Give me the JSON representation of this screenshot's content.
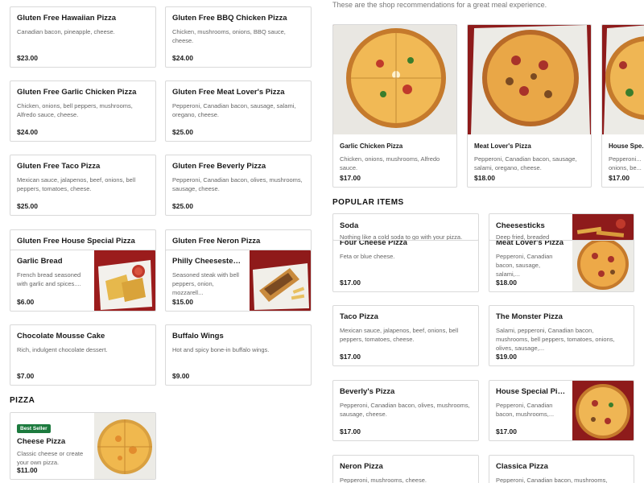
{
  "left_cards": [
    {
      "title": "Gluten Free Hawaiian Pizza",
      "desc": "Canadian bacon, pineapple, cheese.",
      "price": "$23.00"
    },
    {
      "title": "Gluten Free BBQ Chicken Pizza",
      "desc": "Chicken, mushrooms, onions, BBQ sauce, cheese.",
      "price": "$24.00"
    },
    {
      "title": "Gluten Free Garlic Chicken Pizza",
      "desc": "Chicken, onions, bell peppers, mushrooms, Alfredo sauce, cheese.",
      "price": "$24.00"
    },
    {
      "title": "Gluten Free Meat Lover's Pizza",
      "desc": "Pepperoni, Canadian bacon, sausage, salami, oregano, cheese.",
      "price": "$25.00"
    },
    {
      "title": "Gluten Free Taco Pizza",
      "desc": "Mexican sauce, jalapenos, beef, onions, bell peppers, tomatoes, cheese.",
      "price": "$25.00"
    },
    {
      "title": "Gluten Free Beverly Pizza",
      "desc": "Pepperoni, Canadian bacon, olives, mushrooms, sausage, cheese.",
      "price": "$25.00"
    },
    {
      "title": "Gluten Free House Special Pizza",
      "desc": "",
      "price": ""
    },
    {
      "title": "Gluten Free Neron Pizza",
      "desc": "",
      "price": ""
    },
    {
      "title": "Garlic Bread",
      "desc": "French bread seasoned with garlic and spices....",
      "price": "$6.00"
    },
    {
      "title": "Philly Cheesesteak...",
      "desc": "Seasoned steak with bell peppers, onion, mozzarell...",
      "price": "$15.00"
    },
    {
      "title": "Chocolate Mousse Cake",
      "desc": "Rich, indulgent chocolate dessert.",
      "price": "$7.00"
    },
    {
      "title": "Buffalo Wings",
      "desc": "Hot and spicy bone-in buffalo wings.",
      "price": "$9.00"
    }
  ],
  "pizza_section": {
    "title": "PIZZA",
    "badge": "Best Seller",
    "card": {
      "title": "Cheese Pizza",
      "desc": "Classic cheese or create your own pizza.",
      "price": "$11.00"
    }
  },
  "recommendations": {
    "intro": "These are the shop recommendations for a great meal experience.",
    "items": [
      {
        "title": "Garlic Chicken Pizza",
        "desc": "Chicken, onions, mushrooms, Alfredo sauce.",
        "price": "$17.00"
      },
      {
        "title": "Meat Lover's Pizza",
        "desc": "Pepperoni, Canadian bacon, sausage, salami, oregano, cheese.",
        "price": "$18.00"
      },
      {
        "title": "House Spe...",
        "desc": "Pepperoni... onions, be...",
        "price": "$17.00"
      }
    ]
  },
  "popular": {
    "title": "POPULAR ITEMS",
    "items": [
      {
        "title": "Soda",
        "desc": "Nothing like a cold soda to go with your pizza.",
        "price": ""
      },
      {
        "title": "Cheesesticks",
        "desc": "Deep fried, breaded",
        "price": ""
      },
      {
        "title": "Four Cheese Pizza",
        "desc": "Feta or blue cheese.",
        "price": "$17.00"
      },
      {
        "title": "Meat Lover's Pizza",
        "desc": "Pepperoni, Canadian bacon, sausage, salami,...",
        "price": "$18.00"
      },
      {
        "title": "Taco Pizza",
        "desc": "Mexican sauce, jalapenos, beef, onions, bell peppers, tomatoes, cheese.",
        "price": "$17.00"
      },
      {
        "title": "The Monster Pizza",
        "desc": "Salami, pepperoni, Canadian bacon, mushrooms, bell peppers, tomatoes, onions, olives, sausage,...",
        "price": "$19.00"
      },
      {
        "title": "Beverly's Pizza",
        "desc": "Pepperoni, Canadian bacon, olives, mushrooms, sausage, cheese.",
        "price": "$17.00"
      },
      {
        "title": "House Special Pizza",
        "desc": "Pepperoni, Canadian bacon, mushrooms,...",
        "price": "$17.00"
      },
      {
        "title": "Neron Pizza",
        "desc": "Pepperoni, mushrooms, cheese.",
        "price": ""
      },
      {
        "title": "Classica Pizza",
        "desc": "Pepperoni, Canadian bacon, mushrooms, cheese.",
        "price": ""
      }
    ]
  },
  "colors": {
    "accent_green": "#1c7a3e",
    "border": "#d9d9d9",
    "sauce_red": "#b22222"
  }
}
